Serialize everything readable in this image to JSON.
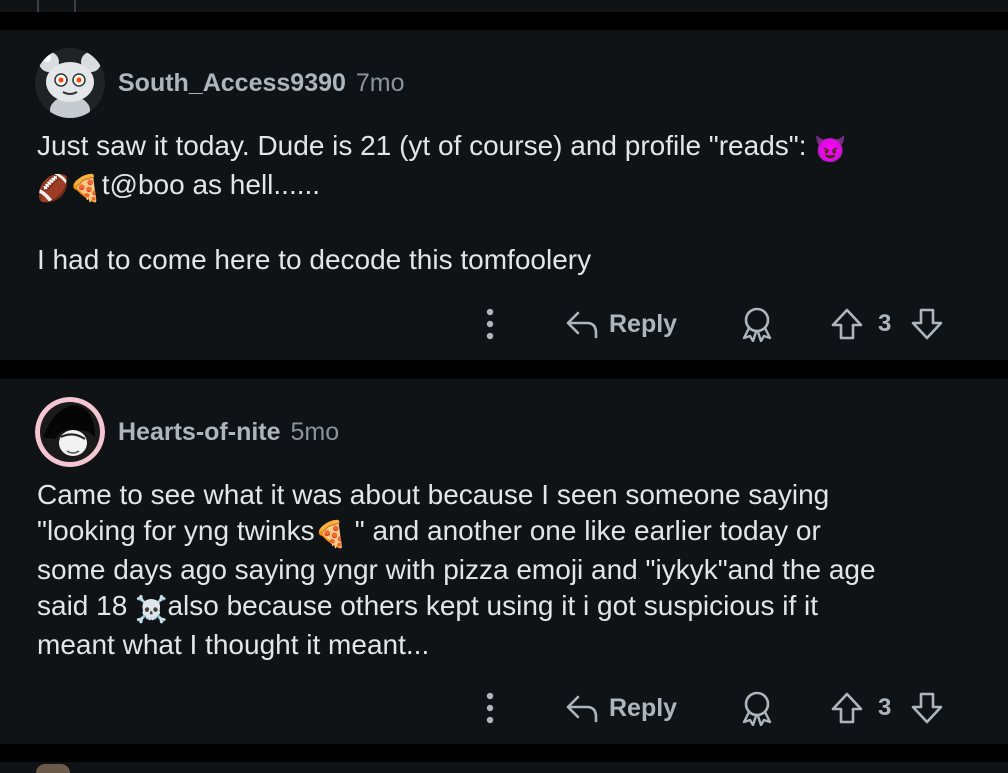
{
  "comments": [
    {
      "username": "South_Access9390",
      "age": "7mo",
      "lines": [
        "Just saw it today. Dude is 21 (yt of course) and profile \"reads\": ",
        "t@boo as hell......",
        "I had to come here to decode this tomfoolery"
      ],
      "emojis": [
        "😈",
        "🏈",
        "🍕"
      ],
      "reply_label": "Reply",
      "vote_count": "3"
    },
    {
      "username": "Hearts-of-nite",
      "age": "5mo",
      "lines": [
        "Came to see what it was about because I seen someone saying",
        "\"looking for yng twinks",
        " \" and another one like earlier today or",
        "some days ago saying yngr with pizza emoji and \"iykyk\"and the age",
        "said 18 ",
        "also because others kept using it i got suspicious if it",
        "meant what I thought it meant..."
      ],
      "emojis": [
        "🍕",
        "☠️"
      ],
      "reply_label": "Reply",
      "vote_count": "3"
    }
  ],
  "icons": [
    "more-options-icon",
    "reply-arrow-icon",
    "award-icon",
    "upvote-arrow-icon",
    "downvote-arrow-icon"
  ],
  "colors": {
    "background": "#000000",
    "card": "#0f1316",
    "username": "#aeb6bd",
    "body_text": "#e3e5e7"
  }
}
